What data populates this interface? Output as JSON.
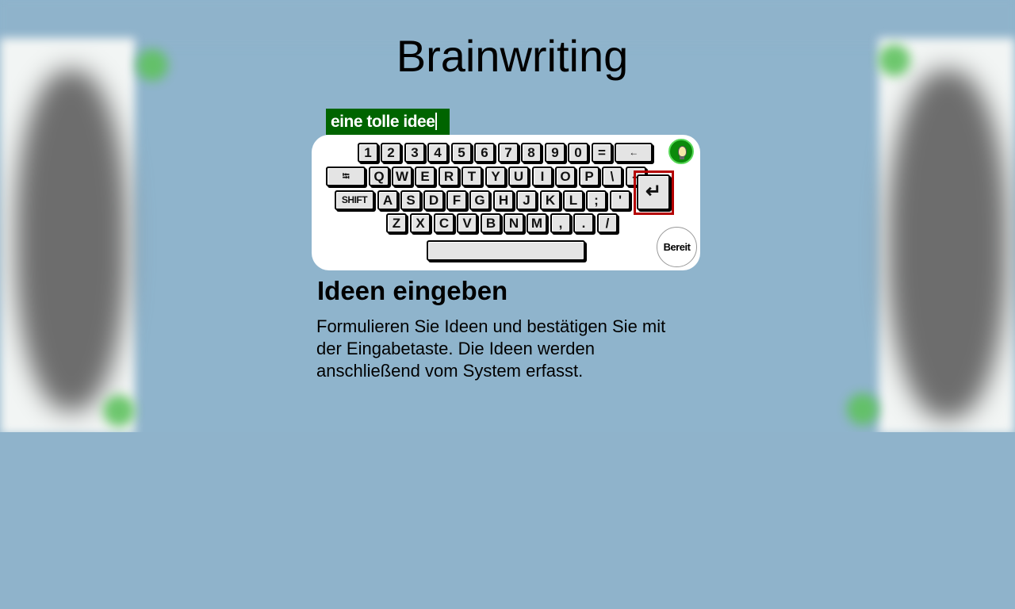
{
  "title": "Brainwriting",
  "input": {
    "value": "eine tolle idee"
  },
  "keyboard": {
    "row1": [
      "1",
      "2",
      "3",
      "4",
      "5",
      "6",
      "7",
      "8",
      "9",
      "0",
      "=",
      "←"
    ],
    "row2": [
      "⭾",
      "Q",
      "W",
      "E",
      "R",
      "T",
      "Y",
      "U",
      "I",
      "O",
      "P",
      "\\",
      "–"
    ],
    "row3": [
      "SHIFT",
      "A",
      "S",
      "D",
      "F",
      "G",
      "H",
      "J",
      "K",
      "L",
      ";",
      "'"
    ],
    "row4": [
      "Z",
      "X",
      "C",
      "V",
      "B",
      "N",
      "M",
      ",",
      ".",
      "/"
    ],
    "enter": "↵",
    "ready_label": "Bereit"
  },
  "instructions": {
    "heading": "Ideen eingeben",
    "text": "Formulieren Sie Ideen und bestätigen Sie mit der Eingabetaste. Die Ideen werden anschließend vom System erfasst."
  },
  "icons": {
    "idea": "lightbulb-icon",
    "tab": "tab-icon",
    "backspace": "backspace-icon",
    "enter": "enter-icon"
  }
}
